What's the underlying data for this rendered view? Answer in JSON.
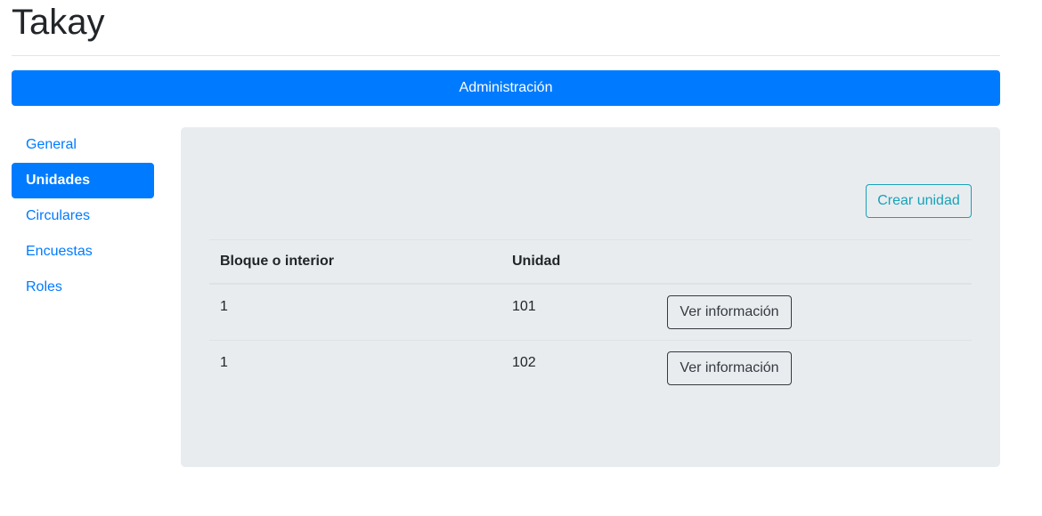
{
  "app": {
    "title": "Takay"
  },
  "banner": {
    "label": "Administración"
  },
  "sidebar": {
    "items": [
      {
        "label": "General",
        "active": false
      },
      {
        "label": "Unidades",
        "active": true
      },
      {
        "label": "Circulares",
        "active": false
      },
      {
        "label": "Encuestas",
        "active": false
      },
      {
        "label": "Roles",
        "active": false
      }
    ]
  },
  "main": {
    "create_button_label": "Crear unidad",
    "table": {
      "headers": [
        "Bloque o interior",
        "Unidad",
        ""
      ],
      "rows": [
        {
          "bloque": "1",
          "unidad": "101",
          "action_label": "Ver información"
        },
        {
          "bloque": "1",
          "unidad": "102",
          "action_label": "Ver información"
        }
      ]
    }
  },
  "colors": {
    "primary": "#007bff",
    "info": "#17a2b8",
    "panel_bg": "#e9ecef",
    "dark": "#343a40"
  }
}
